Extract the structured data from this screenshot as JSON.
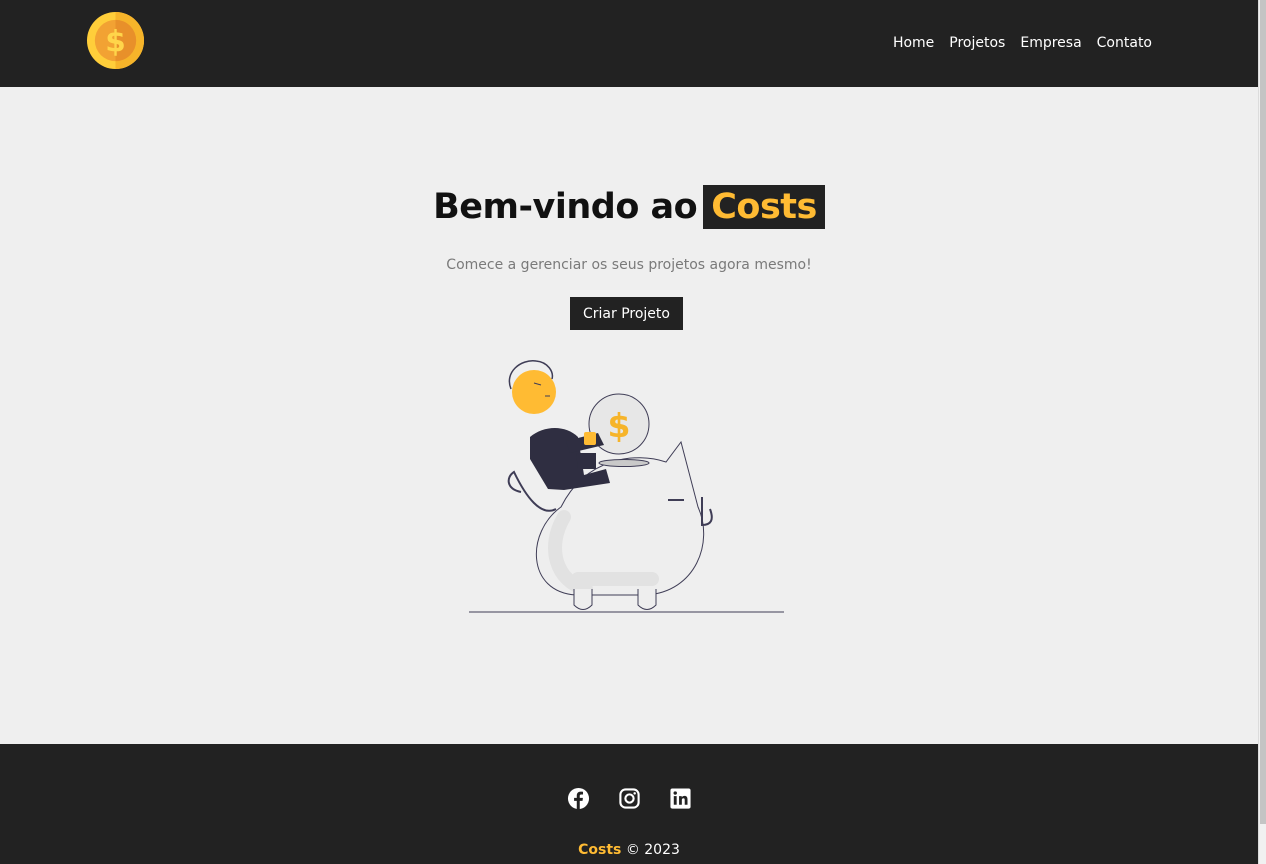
{
  "navbar": {
    "logo_icon": "dollar-coin-icon",
    "links": [
      {
        "label": "Home"
      },
      {
        "label": "Projetos"
      },
      {
        "label": "Empresa"
      },
      {
        "label": "Contato"
      }
    ]
  },
  "hero": {
    "title_prefix": "Bem-vindo ao",
    "title_brand": "Costs",
    "subtitle": "Comece a gerenciar os seus projetos agora mesmo!",
    "cta_label": "Criar Projeto",
    "illustration": "man-with-piggy-bank-illustration"
  },
  "footer": {
    "social_icons": [
      "facebook-icon",
      "instagram-icon",
      "linkedin-icon"
    ],
    "brand": "Costs",
    "copyright": "© 2023"
  },
  "colors": {
    "dark": "#222222",
    "accent": "#ffbb33",
    "background": "#efefef"
  }
}
